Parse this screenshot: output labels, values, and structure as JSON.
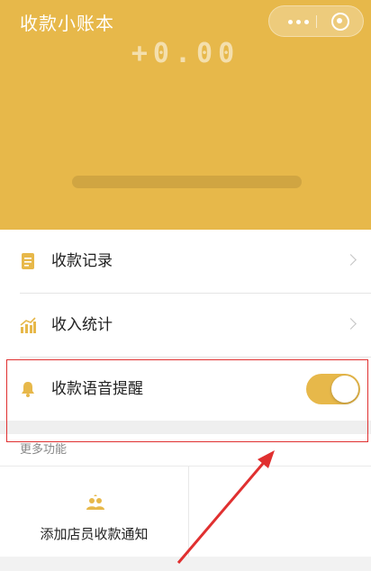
{
  "app": {
    "title": "收款小账本"
  },
  "header": {
    "amount": "+0.00"
  },
  "menu": {
    "items": [
      {
        "label": "收款记录",
        "icon": "document-icon"
      },
      {
        "label": "收入统计",
        "icon": "chart-icon"
      }
    ],
    "voice_alert": {
      "label": "收款语音提醒",
      "icon": "bell-icon",
      "enabled": true
    }
  },
  "more": {
    "title": "更多功能",
    "items": [
      {
        "label": "添加店员收款通知",
        "icon": "staff-icon"
      }
    ]
  },
  "colors": {
    "accent": "#e7b84a",
    "annotation": "#e03030"
  }
}
